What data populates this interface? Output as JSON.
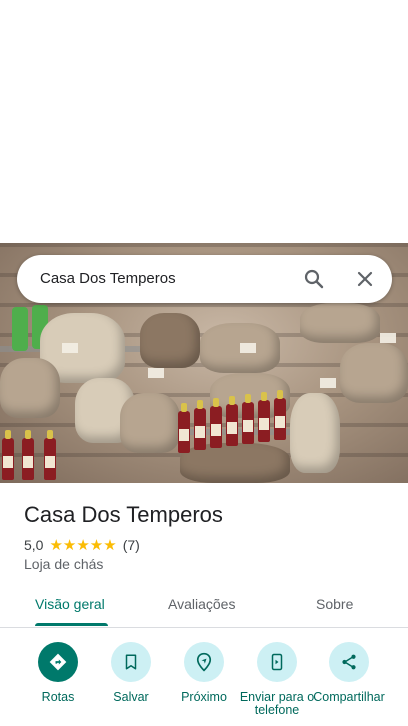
{
  "search": {
    "query": "Casa Dos Temperos"
  },
  "place": {
    "name": "Casa Dos Temperos",
    "rating": "5,0",
    "stars": "★★★★★",
    "review_count": "(7)",
    "category": "Loja de chás"
  },
  "tabs": [
    {
      "label": "Visão geral",
      "active": true
    },
    {
      "label": "Avaliações",
      "active": false
    },
    {
      "label": "Sobre",
      "active": false
    }
  ],
  "actions": [
    {
      "label": "Rotas",
      "icon": "directions-icon"
    },
    {
      "label": "Salvar",
      "icon": "bookmark-icon"
    },
    {
      "label": "Próximo",
      "icon": "nearby-icon"
    },
    {
      "label": "Enviar para o telefone",
      "icon": "send-to-phone-icon"
    },
    {
      "label": "Compartilhar",
      "icon": "share-icon"
    }
  ],
  "colors": {
    "accent": "#00796b",
    "action_bg": "#cdf0f4",
    "star": "#fbbc04"
  }
}
